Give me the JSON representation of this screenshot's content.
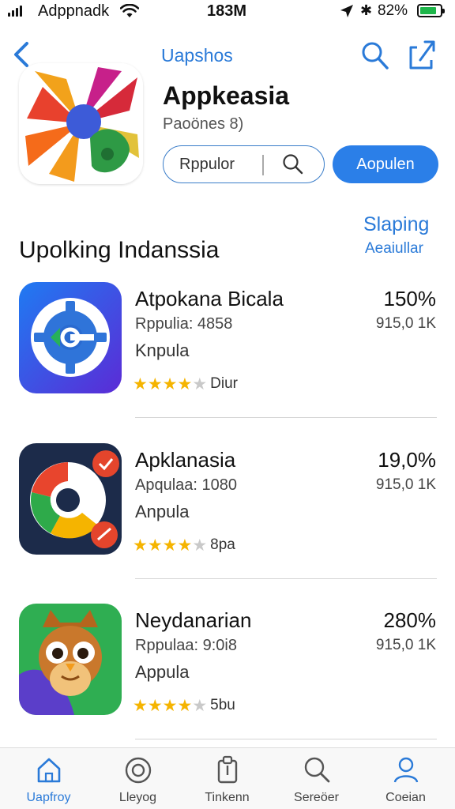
{
  "status_bar": {
    "carrier": "Adppnadk",
    "time": "183M",
    "battery": "82%",
    "battery_level": 0.82,
    "battery_color": "#1db64a"
  },
  "nav": {
    "title": "Uapshos"
  },
  "app": {
    "name": "Appkeasia",
    "subtitle": "Paoönes 8)",
    "search_pill_text": "Rppulor",
    "primary_button": "Aopulen"
  },
  "section": {
    "title": "Upolking Indanssia",
    "link": "Slaping",
    "sublink": "Aeaiullar"
  },
  "apps": [
    {
      "title": "Atpokana Bicala",
      "meta": "Rppulia: 4858",
      "category": "Knpula",
      "stars": 3.5,
      "rating_text": "Diur",
      "percent": "150%",
      "size": "915,0 1K"
    },
    {
      "title": "Apklanasia",
      "meta": "Apqulaa: 1080",
      "category": "Anpula",
      "stars": 3.5,
      "rating_text": "8pa",
      "percent": "19,0%",
      "size": "915,0 1K"
    },
    {
      "title": "Neydanarian",
      "meta": "Rppulaa: 9:0i8",
      "category": "Appula",
      "stars": 3.5,
      "rating_text": "5bu",
      "percent": "280%",
      "size": "915,0 1K"
    }
  ],
  "tabs": [
    {
      "label": "Uapfroy",
      "icon": "home-icon",
      "active": true
    },
    {
      "label": "Lleyog",
      "icon": "disc-icon",
      "active": false
    },
    {
      "label": "Tinkenn",
      "icon": "clipboard-icon",
      "active": false
    },
    {
      "label": "Sereöer",
      "icon": "search-icon",
      "active": false
    },
    {
      "label": "Coeian",
      "icon": "person-icon",
      "active": false
    }
  ],
  "colors": {
    "accent": "#2b7fe8",
    "link": "#2a7ad8",
    "star": "#f5b400"
  }
}
